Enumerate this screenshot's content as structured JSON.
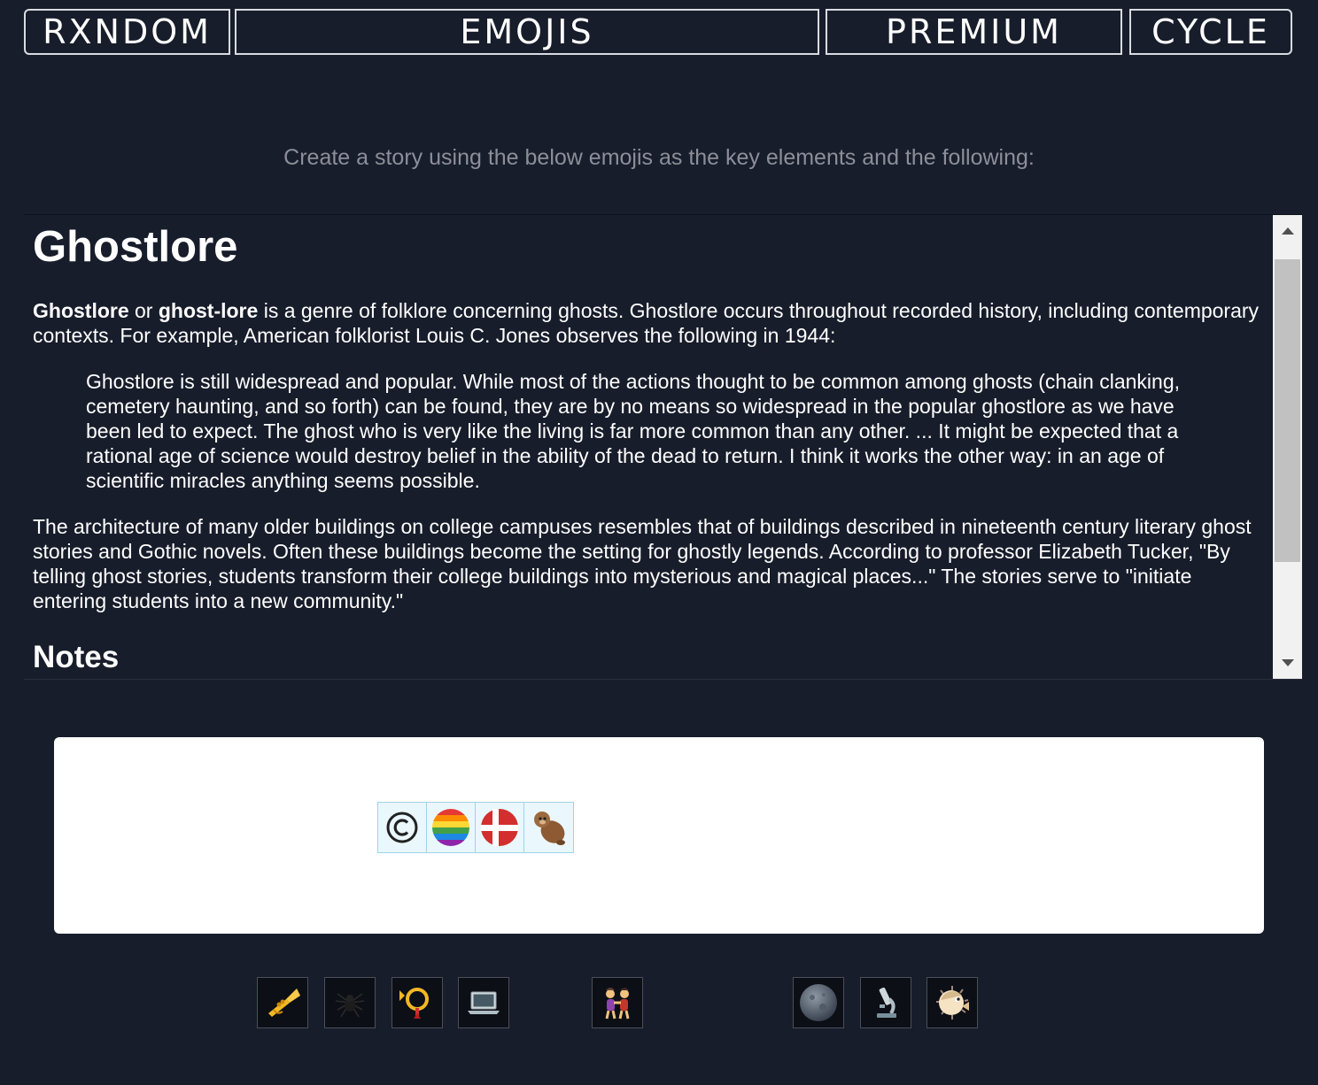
{
  "nav": {
    "random_label": "RXNDOM",
    "emojis_label": "EMOJIS",
    "premium_label": "PREMIUM",
    "cycle_label": "CYCLE"
  },
  "prompt": "Create a story using the below emojis as the key elements and the following:",
  "article": {
    "title": "Ghostlore",
    "intro_bold_1": "Ghostlore",
    "intro_or": " or ",
    "intro_bold_2": "ghost-lore",
    "intro_rest": " is a genre of folklore concerning ghosts. Ghostlore occurs throughout recorded history, including contemporary contexts. For example, American folklorist Louis C. Jones observes the following in 1944:",
    "quote": "Ghostlore is still widespread and popular. While most of the actions thought to be common among ghosts (chain clanking, cemetery haunting, and so forth) can be found, they are by no means so widespread in the popular ghostlore as we have been led to expect. The ghost who is very like the living is far more common than any other. ... It might be expected that a rational age of science would destroy belief in the ability of the dead to return. I think it works the other way: in an age of scientific miracles anything seems possible.",
    "paragraph2": "The architecture of many older buildings on college campuses resembles that of buildings described in nineteenth century literary ghost stories and Gothic novels. Often these buildings become the setting for ghostly legends. According to professor Elizabeth Tucker, \"By telling ghost stories, students transform their college buildings into mysterious and magical places...\" The stories serve to \"initiate entering students into a new community.\"",
    "notes_heading": "Notes"
  },
  "selected_emojis": [
    {
      "icon": "copyright-icon"
    },
    {
      "icon": "rainbow-circle-icon"
    },
    {
      "icon": "denmark-flag-icon"
    },
    {
      "icon": "otter-icon"
    }
  ],
  "emoji_tiles": [
    {
      "icon": "trumpet-icon"
    },
    {
      "icon": "spider-icon"
    },
    {
      "icon": "postal-horn-icon"
    },
    {
      "icon": "laptop-icon"
    },
    {
      "icon": "women-wrestling-icon"
    },
    {
      "icon": "moon-icon"
    },
    {
      "icon": "microscope-icon"
    },
    {
      "icon": "blowfish-icon"
    }
  ],
  "colors": {
    "background": "#181d2b",
    "prompt_text": "#8c8f99",
    "selection_border": "#9fd3ea"
  }
}
